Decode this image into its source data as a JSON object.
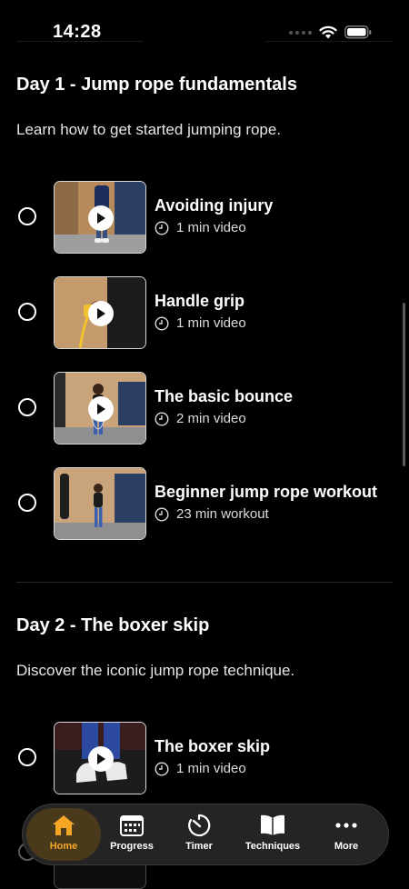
{
  "status_bar": {
    "time": "14:28"
  },
  "days": [
    {
      "title": "Day 1 - Jump rope fundamentals",
      "description": "Learn how to get started jumping rope.",
      "lessons": [
        {
          "title": "Avoiding injury",
          "meta": "1 min video"
        },
        {
          "title": "Handle grip",
          "meta": "1 min video"
        },
        {
          "title": "The basic bounce",
          "meta": "2 min video"
        },
        {
          "title": "Beginner jump rope workout",
          "meta": "23 min workout"
        }
      ]
    },
    {
      "title": "Day 2 - The boxer skip",
      "description": "Discover the iconic jump rope technique.",
      "lessons": [
        {
          "title": "The boxer skip",
          "meta": "1 min video"
        }
      ]
    }
  ],
  "tab_bar": {
    "active": "Home",
    "tabs": [
      {
        "label": "Home",
        "icon": "home-icon"
      },
      {
        "label": "Progress",
        "icon": "calendar-icon"
      },
      {
        "label": "Timer",
        "icon": "timer-icon"
      },
      {
        "label": "Techniques",
        "icon": "book-icon"
      },
      {
        "label": "More",
        "icon": "more-icon"
      }
    ]
  },
  "colors": {
    "background": "#000000",
    "accent": "#f5a623"
  }
}
